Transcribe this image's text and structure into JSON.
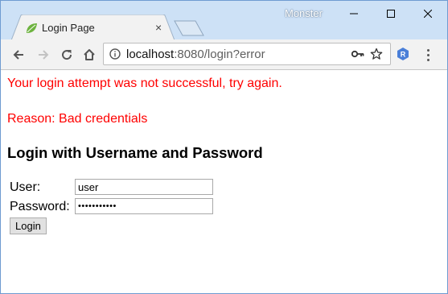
{
  "window": {
    "profile_name": "Monster"
  },
  "tab": {
    "title": "Login Page",
    "close_glyph": "×",
    "favicon": "spring-leaf-icon"
  },
  "toolbar": {
    "url_host": "localhost",
    "url_rest": ":8080/login?error",
    "extension_letter": "R"
  },
  "page": {
    "error_message": "Your login attempt was not successful, try again.",
    "reason": "Reason: Bad credentials",
    "heading": "Login with Username and Password",
    "user_label": "User:",
    "user_value": "user",
    "password_label": "Password:",
    "password_value": "•••••••••••",
    "login_button": "Login"
  },
  "colors": {
    "error": "#ff0000",
    "titlebar": "#cde1f6",
    "accent": "#4a7fd8"
  }
}
